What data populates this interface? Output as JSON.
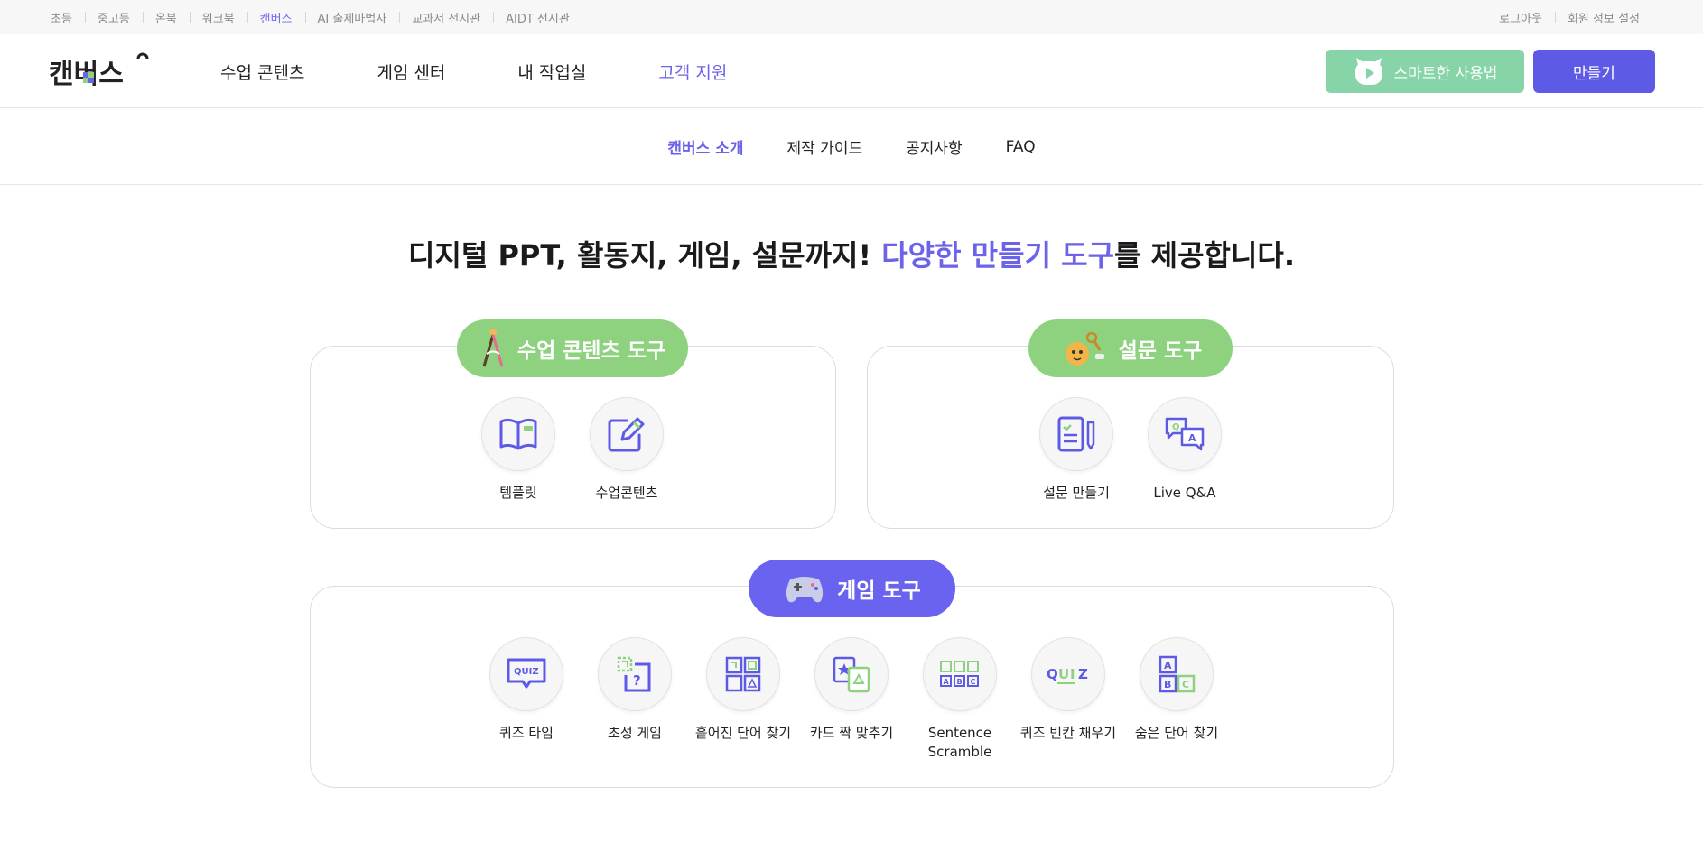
{
  "utility_nav": {
    "left": [
      "초등",
      "중고등",
      "온북",
      "워크북",
      "캔버스",
      "AI 출제마법사",
      "교과서 전시관",
      "AIDT 전시관"
    ],
    "active": "캔버스",
    "right": [
      "로그아웃",
      "회원 정보 설정"
    ]
  },
  "header": {
    "logo_text": "캔버스",
    "nav": [
      "수업 콘텐츠",
      "게임 센터",
      "내 작업실",
      "고객 지원"
    ],
    "active_nav": "고객 지원",
    "guide_button": "스마트한 사용법",
    "create_button": "만들기"
  },
  "subnav": {
    "items": [
      "캔버스 소개",
      "제작 가이드",
      "공지사항",
      "FAQ"
    ],
    "active": "캔버스 소개"
  },
  "headline": {
    "prefix": "디지털 PPT, 활동지, 게임, 설문까지! ",
    "highlight": "다양한 만들기 도구",
    "suffix": "를 제공합니다."
  },
  "sections": {
    "lesson": {
      "title": "수업 콘텐츠 도구",
      "tools": [
        "템플릿",
        "수업콘텐츠"
      ]
    },
    "survey": {
      "title": "설문 도구",
      "tools": [
        "설문 만들기",
        "Live Q&A"
      ]
    },
    "game": {
      "title": "게임 도구",
      "tools": [
        "퀴즈 타임",
        "초성 게임",
        "흩어진 단어 찾기",
        "카드 짝 맞추기",
        "Sentence\nScramble",
        "퀴즈 빈칸 채우기",
        "숨은 단어 찾기"
      ]
    }
  },
  "colors": {
    "brand_purple": "#5d5ae6",
    "accent_purple": "#6b63e8",
    "green": "#8ed27f",
    "mint": "#86d4a8"
  }
}
